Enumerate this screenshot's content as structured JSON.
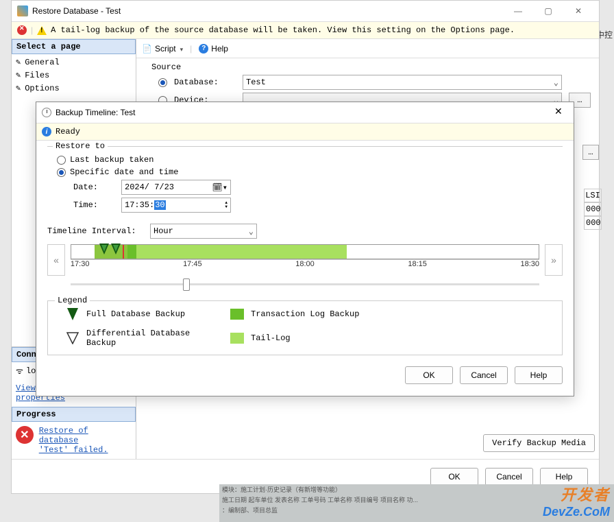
{
  "main": {
    "title": "Restore Database - Test",
    "status": "A tail-log backup of the source database will be taken. View this setting on the Options page."
  },
  "sidebar": {
    "header": "Select a page",
    "items": [
      "General",
      "Files",
      "Options"
    ],
    "connection_header": "Conne",
    "connection_body": "lo",
    "link": "View connection properties",
    "progress_header": "Progress",
    "progress_msg1": "Restore of database ",
    "progress_msg2": "'Test' failed."
  },
  "toolbar": {
    "script": "Script",
    "help": "Help"
  },
  "form": {
    "source": "Source",
    "database_label": "Database:",
    "database_value": "Test",
    "device_label": "Device:"
  },
  "verify_btn": "Verify Backup Media",
  "footer": {
    "ok": "OK",
    "cancel": "Cancel",
    "help": "Help"
  },
  "modal": {
    "title": "Backup Timeline: Test",
    "status": "Ready",
    "restore_to": "Restore to",
    "opt_last": "Last backup taken",
    "opt_specific": "Specific date and time",
    "date_label": "Date:",
    "date_value": "2024/ 7/23",
    "time_label": "Time:",
    "time_prefix": "17:35:",
    "time_sel": "30",
    "interval_label": "Timeline Interval:",
    "interval_value": "Hour",
    "ticks": [
      "17:30",
      "17:45",
      "18:00",
      "18:15",
      "18:30"
    ],
    "legend_title": "Legend",
    "leg_full": "Full Database Backup",
    "leg_diff": "Differential Database Backup",
    "leg_tlog": "Transaction Log Backup",
    "leg_tail": "Tail-Log",
    "ok": "OK",
    "cancel": "Cancel",
    "help": "Help"
  },
  "peek": {
    "rt": "中控",
    "col": "LSI",
    "v1": "000",
    "v2": "000"
  },
  "logo": {
    "l1": "开发者",
    "l2": "DevZe.CoM"
  }
}
